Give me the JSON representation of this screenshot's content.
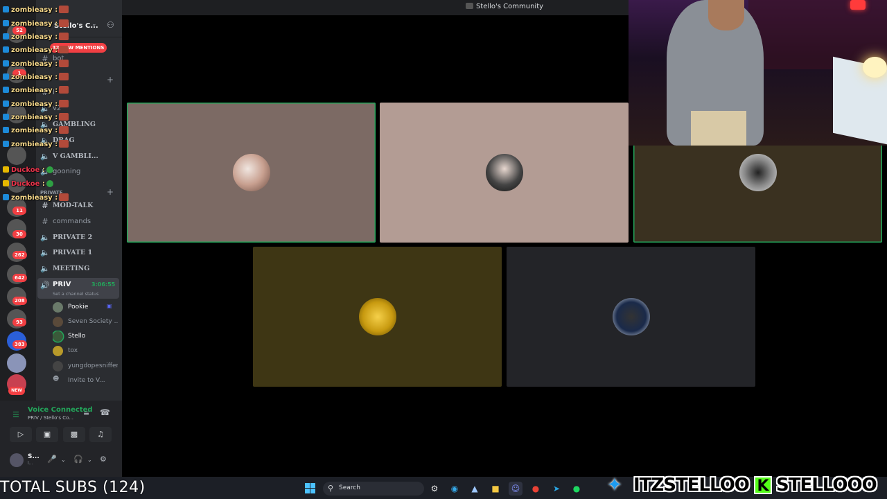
{
  "window": {
    "title": "Stello's Community"
  },
  "server": {
    "name": "Stello's C...",
    "mentions": "32 NEW MENTIONS"
  },
  "rail": {
    "badges": [
      "52",
      "1",
      "11",
      "30",
      "262",
      "642",
      "208",
      "93",
      "383"
    ],
    "new": "NEW"
  },
  "channels": {
    "bot": "bot",
    "l": "l",
    "v2": "v2",
    "gambling": "GAMBLING",
    "drag": "DRAG",
    "gambli": "V GAMBLI...",
    "gooning": "gooning",
    "private_cat": "PRIVATE",
    "modtalk": "MOD-TALK",
    "commands": "commands",
    "private2": "PRIVATE 2",
    "private1": "PRIVATE 1",
    "meeting": "MEETING",
    "priv": "PRIV",
    "priv_timer": "3:06:55",
    "priv_status": "Set a channel status",
    "members": [
      "Pookie",
      "Seven Society ...",
      "Stello",
      "tox",
      "yungdopesniffer"
    ],
    "invite": "Invite to V..."
  },
  "chat": {
    "lines": [
      {
        "user": "zombieasy",
        "sep": ":"
      },
      {
        "user": "zombieasy",
        "sep": ":"
      },
      {
        "user": "zombieasy",
        "sep": ":"
      },
      {
        "user": "zombieasy",
        "sep": ":"
      },
      {
        "user": "zombieasy",
        "sep": ":"
      },
      {
        "user": "zombieasy",
        "sep": ":"
      },
      {
        "user": "zombieasy",
        "sep": ":"
      },
      {
        "user": "zombieasy",
        "sep": ":"
      },
      {
        "user": "zombieasy",
        "sep": ":"
      },
      {
        "user": "zombieasy",
        "sep": ":"
      },
      {
        "user": "zombieasy",
        "sep": ":"
      },
      {
        "user": "Duckoe",
        "sep": ":"
      },
      {
        "user": "Duckoe",
        "sep": ":"
      },
      {
        "user": "zombieasy",
        "sep": ":"
      }
    ]
  },
  "voice": {
    "status": "Voice Connected",
    "location": "PRIV / Stello's Co...",
    "user": "S...",
    "user_sub": "l..."
  },
  "tiles": [
    {
      "bg": "#7c6a64"
    },
    {
      "bg": "#b39c94"
    },
    {
      "bg": "#3a3120"
    },
    {
      "bg": "#3e3614"
    },
    {
      "bg": "#232428"
    }
  ],
  "overlay": {
    "subs": "TOTAL SUBS (124)",
    "twitter": "ITZSTELLOO",
    "kick_letter": "K",
    "kick": "STELLOOO"
  },
  "taskbar": {
    "search": "Search"
  },
  "colors": {
    "accent_green": "#23a55a",
    "danger": "#f23f43",
    "blurple": "#5865f2"
  }
}
